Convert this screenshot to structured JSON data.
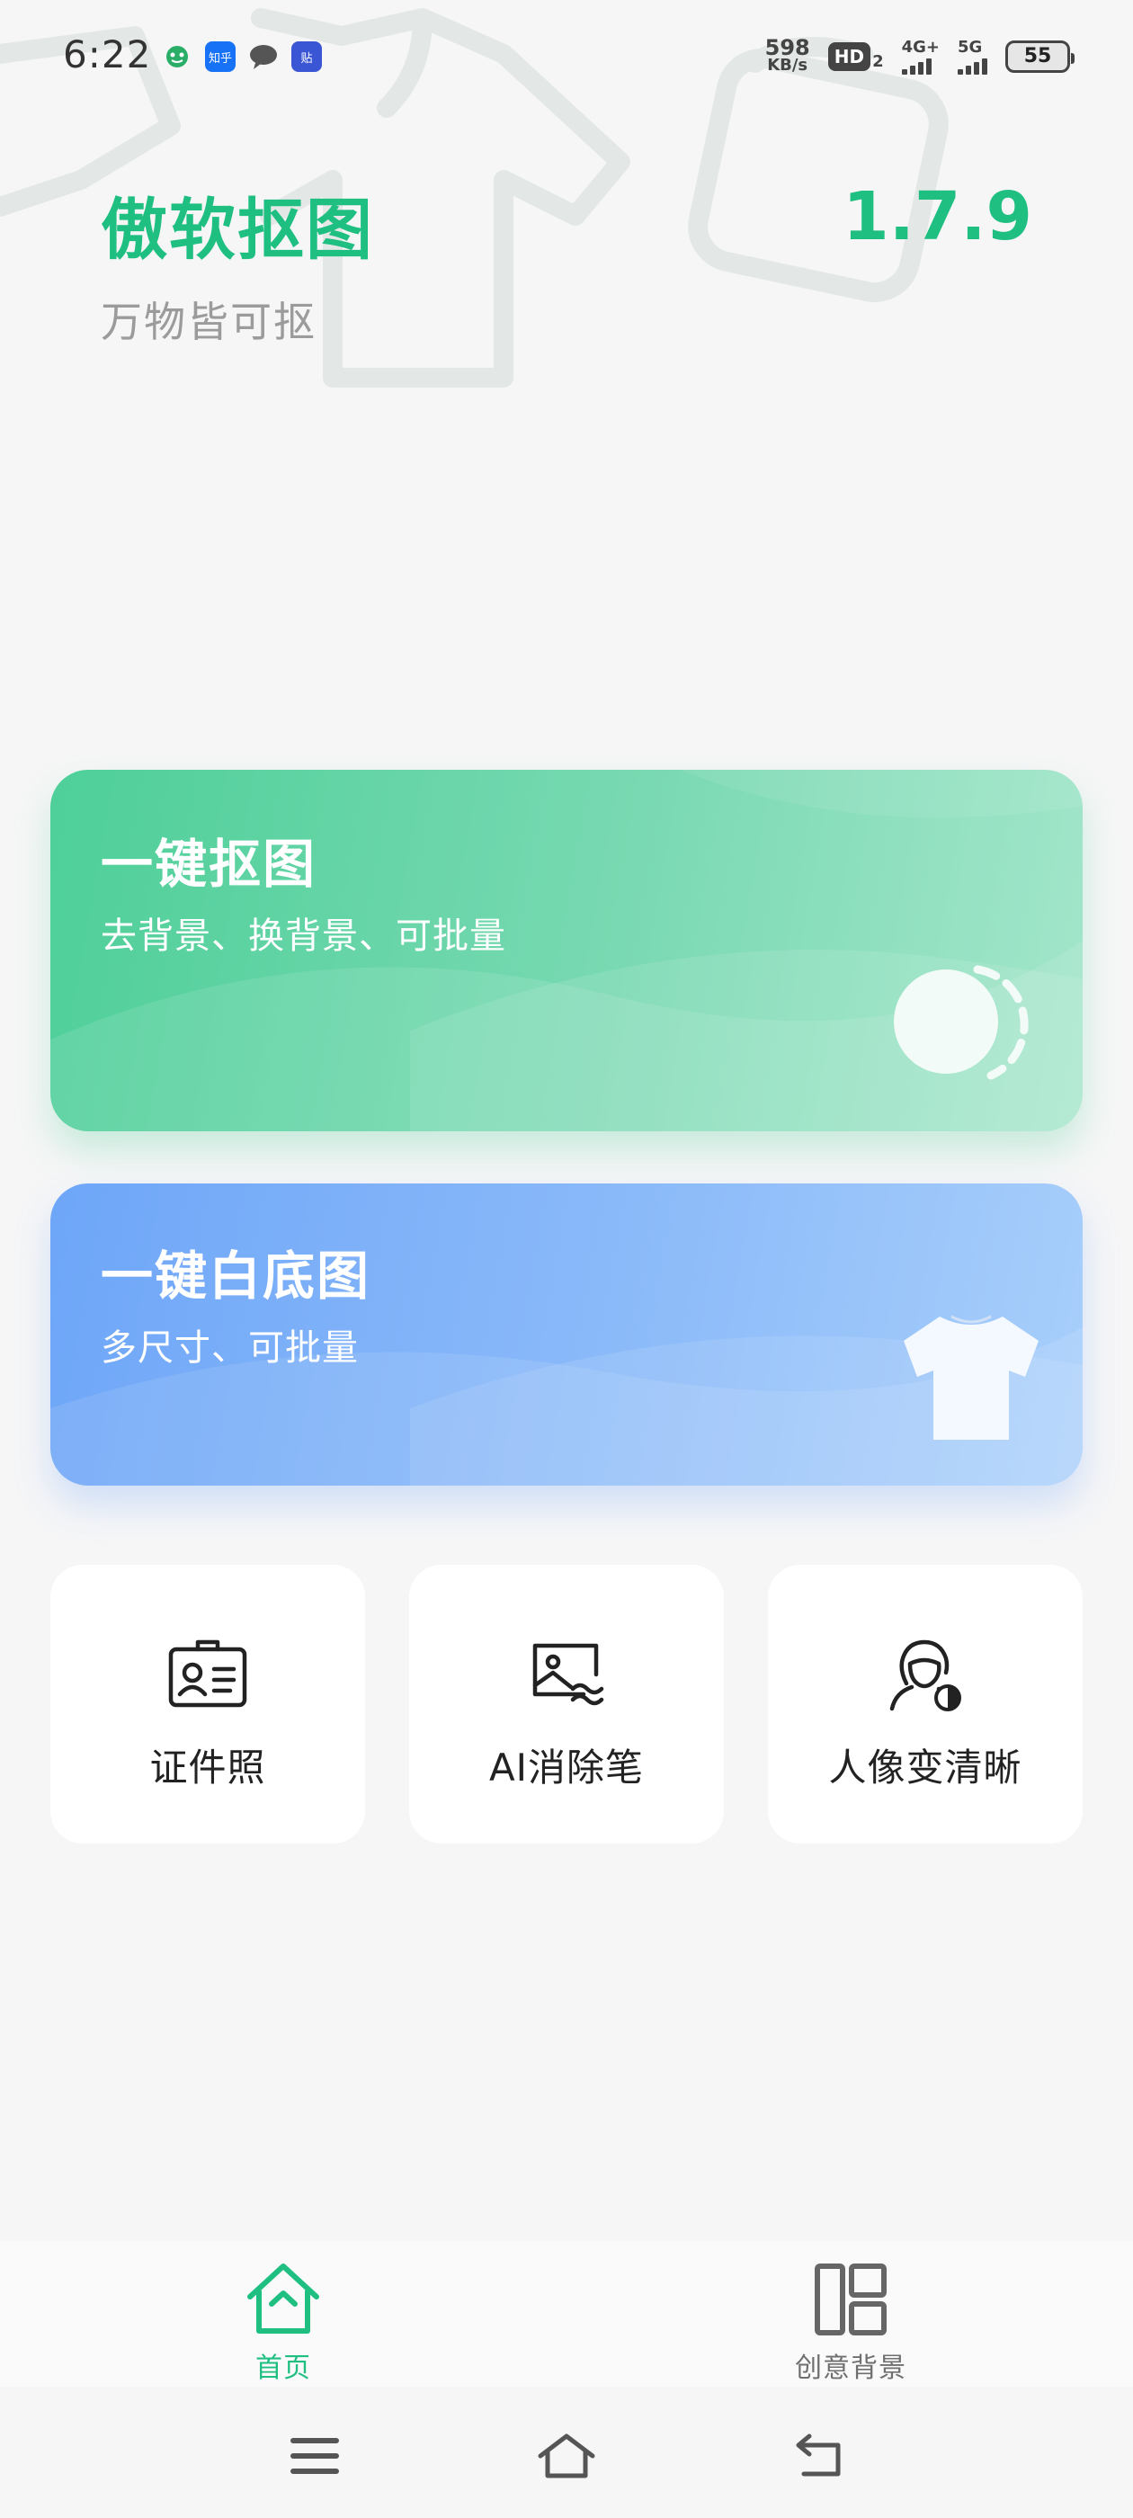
{
  "status_bar": {
    "time": "6:22",
    "net_speed_value": "598",
    "net_speed_unit": "KB/s",
    "hd_label": "HD",
    "hd_sub": "2",
    "network_1": "4G+",
    "network_2": "5G",
    "battery": "55",
    "notification_apps": [
      "wechat-icon",
      "zhihu-icon",
      "message-icon",
      "tieba-icon"
    ],
    "app_labels": {
      "zhihu": "知乎",
      "tieba": "贴"
    }
  },
  "header": {
    "title": "傲软抠图",
    "version": "1.7.9",
    "subtitle": "万物皆可抠"
  },
  "cards": [
    {
      "title": "一键抠图",
      "desc": "去背景、换背景、可批量",
      "icon": "toggle-circle-icon"
    },
    {
      "title": "一键白底图",
      "desc": "多尺寸、可批量",
      "icon": "tshirt-icon"
    }
  ],
  "tools": [
    {
      "label": "证件照",
      "icon": "id-card-icon"
    },
    {
      "label": "AI消除笔",
      "icon": "image-eraser-icon"
    },
    {
      "label": "人像变清晰",
      "icon": "portrait-enhance-icon"
    }
  ],
  "bottom_nav": {
    "items": [
      {
        "label": "首页",
        "icon": "home-icon",
        "active": true
      },
      {
        "label": "创意背景",
        "icon": "layout-icon",
        "active": false
      }
    ]
  },
  "colors": {
    "accent": "#1fbf82",
    "card_green": "#4ecf99",
    "card_blue": "#6ea6f8",
    "background": "#f6f6f7"
  }
}
